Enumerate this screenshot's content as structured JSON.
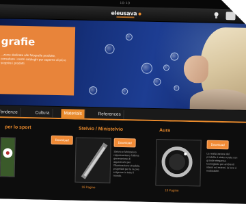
{
  "status": {
    "time": "10:10"
  },
  "header": {
    "brand": "eleusava"
  },
  "hero": {
    "title": "grafie",
    "text": "...zione dedicata alle fotografie prodotte, consultare i nostri cataloghi per saperne di più e scoprire i prodotti."
  },
  "tabs": [
    {
      "label": "Tendenze",
      "active": false
    },
    {
      "label": "Cultura",
      "active": false
    },
    {
      "label": "Materials",
      "active": true
    },
    {
      "label": "References",
      "active": false
    }
  ],
  "columns": [
    {
      "title": "per lo sport",
      "button": "Download",
      "pages": ""
    },
    {
      "title": "Stelvio / Ministelvio",
      "button": "Download",
      "desc": "Stelvio e Ministelvio rappresentano l'ultima generazione di apparecchi per l'illuminazione stradale, progettati per le nuove esigenze in tutto il mondo.",
      "pages": "16 Pagine"
    },
    {
      "title": "Aura",
      "button": "Download",
      "desc": "La realizzazione del prodotto è stata curata con grande eleganza. Consigliato per ambienti interni ed esterni, la luce è modulabile.",
      "pages": "16 Pagine"
    }
  ],
  "colors": {
    "accent": "#e98a2c"
  }
}
